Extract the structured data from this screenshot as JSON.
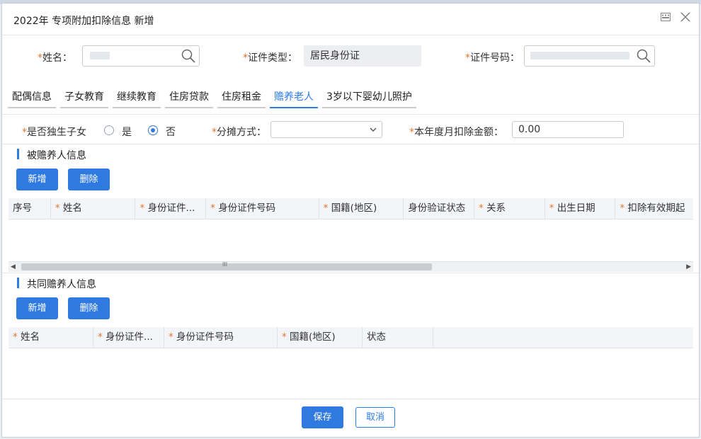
{
  "dialog": {
    "title": "2022年 专项附加扣除信息 新增"
  },
  "top_fields": {
    "name_label": "姓名：",
    "id_type_label": "证件类型：",
    "id_type_value": "居民身份证",
    "id_number_label": "证件号码："
  },
  "tabs": [
    {
      "label": "配偶信息"
    },
    {
      "label": "子女教育"
    },
    {
      "label": "继续教育"
    },
    {
      "label": "住房贷款"
    },
    {
      "label": "住房租金"
    },
    {
      "label": "赡养老人"
    },
    {
      "label": "3岁以下婴幼儿照护"
    }
  ],
  "form_row": {
    "only_child_label": "是否独生子女",
    "yes_label": "是",
    "no_label": "否",
    "only_child_selected": "否",
    "split_label": "分摊方式：",
    "split_value": "",
    "monthly_label": "本年度月扣除金额：",
    "monthly_value": "0.00"
  },
  "supported_section": {
    "title": "被赡养人信息",
    "add_label": "新增",
    "delete_label": "删除",
    "columns": [
      {
        "label": "序号",
        "required": false
      },
      {
        "label": "姓名",
        "required": true
      },
      {
        "label": "身份证件...",
        "required": true
      },
      {
        "label": "身份证件号码",
        "required": true
      },
      {
        "label": "国籍(地区)",
        "required": true
      },
      {
        "label": "身份验证状态",
        "required": false
      },
      {
        "label": "关系",
        "required": true
      },
      {
        "label": "出生日期",
        "required": true
      },
      {
        "label": "扣除有效期起",
        "required": true
      }
    ],
    "scroll_grip": "III"
  },
  "co_supporter_section": {
    "title": "共同赡养人信息",
    "add_label": "新增",
    "delete_label": "删除",
    "columns": [
      {
        "label": "姓名",
        "required": true
      },
      {
        "label": "身份证件...",
        "required": true
      },
      {
        "label": "身份证件号码",
        "required": true
      },
      {
        "label": "国籍(地区)",
        "required": true
      },
      {
        "label": "状态",
        "required": false
      }
    ]
  },
  "footer": {
    "save_label": "保存",
    "cancel_label": "取消"
  },
  "colors": {
    "accent": "#2d7be5",
    "required": "#e8762c",
    "header_bg": "#f3f5f8"
  }
}
